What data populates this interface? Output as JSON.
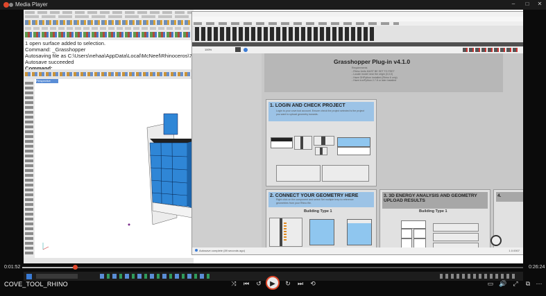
{
  "window": {
    "title": "Media Player",
    "minimize": "–",
    "maximize": "□",
    "close": "✕"
  },
  "rhino": {
    "command_lines": [
      "1 open surface added to selection.",
      "Command: _Grasshopper",
      "Autosaving file as C:\\Users\\nehaa\\AppData\\Local\\McNeel\\Rhinoceros\\7.0\\AutoSave",
      "Autosave succeeded"
    ],
    "command_prompt": "Command:",
    "viewport_name": "Perspective"
  },
  "grasshopper": {
    "plugin_title": "Grasshopper Plug-in v4.1.0",
    "requirements": [
      "Requirements",
      "- Rhino Units MUST BE SET TO FEET",
      "- Locate model near the origin (0,0,0)",
      "- Have GHPython installed (Rhino 6 only)",
      "- Have ironPython 2.7.8 or later installed"
    ],
    "panels": [
      {
        "title": "1. LOGIN AND CHECK PROJECT",
        "note": "Login to your cove.tool account. Ensure check the project selected is the project you want to upload geometry towards."
      },
      {
        "title": "2. CONNECT YOUR GEOMETRY HERE",
        "note": "Right click on the component and select Set multiple brep to reference geometries from your Rhino file.",
        "subtitle": "Building Type 1"
      },
      {
        "title": "3. 3D ENERGY ANALYSIS AND GEOMETRY UPLOAD RESULTS",
        "subtitle": "Building Type 1"
      },
      {
        "title": "4."
      }
    ],
    "status_text": "Autosave complete (89 seconds ago)",
    "version": "1.0.0007",
    "zoom": "100%"
  },
  "player": {
    "current_time": "0:01:52",
    "total_time": "0:26:24",
    "progress": 0.105,
    "video_name": "COVE_TOOL_RHINO",
    "icons": [
      "shuffle-icon",
      "previous-icon",
      "rewind-icon",
      "play-icon",
      "forward-icon",
      "next-icon",
      "repeat-icon",
      "captions-icon",
      "volume-icon",
      "fullscreen-icon",
      "miniplayer-icon",
      "more-icon"
    ]
  },
  "colors": {
    "accent": "#e0482c",
    "gh_blue": "#9cc3e6",
    "rhino_blue": "#2f86d6"
  }
}
